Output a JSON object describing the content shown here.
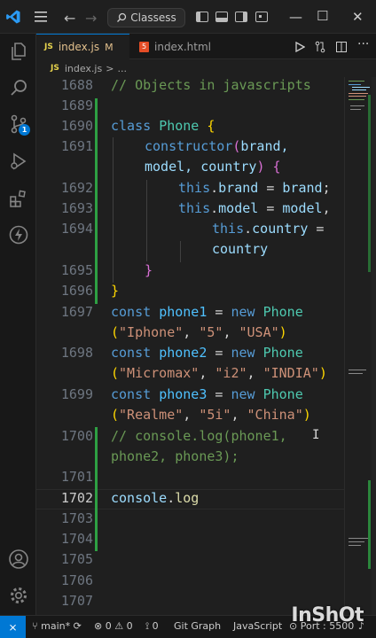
{
  "titlebar": {
    "search": "Classess",
    "icons": [
      "vscode-logo-icon",
      "menu-icon",
      "back-arrow-icon",
      "forward-arrow-icon",
      "search-icon",
      "layout-sidebar-left-icon",
      "layout-panel-icon",
      "layout-sidebar-right-icon",
      "customize-layout-icon",
      "minimize-icon",
      "maximize-icon",
      "close-icon"
    ]
  },
  "activitybar": {
    "icons": [
      "explorer-icon",
      "search-icon",
      "source-control-icon",
      "run-debug-icon",
      "extensions-icon",
      "lightning-icon",
      "account-icon",
      "settings-gear-icon"
    ],
    "scm_badge": "1"
  },
  "tabs": [
    {
      "icon": "JS",
      "label": "index.js",
      "modified": "M"
    },
    {
      "icon": "5",
      "label": "index.html"
    }
  ],
  "breadcrumb": {
    "icon": "JS",
    "file": "index.js",
    "sep": ">",
    "more": "..."
  },
  "editor": {
    "line_numbers": [
      "1688",
      "1689",
      "1690",
      "1691",
      "",
      "1692",
      "1693",
      "1694",
      "",
      "1695",
      "1696",
      "1697",
      "",
      "1698",
      "",
      "1699",
      "",
      "1700",
      "",
      "1701",
      "1702",
      "1703",
      "1704",
      "1705",
      "1706",
      "1707"
    ],
    "current_line": "1702",
    "code": {
      "l1": "// Objects in javascripts",
      "class_kw": "class",
      "class_name": "Phone",
      "ctor": "constructor",
      "ctor_p1": "brand,",
      "ctor_p2": "model,",
      "ctor_p3": "country",
      "this": "this",
      "prop_brand": "brand",
      "prop_model": "model",
      "prop_country": "country",
      "const": "const",
      "new": "new",
      "phone1": "phone1",
      "phone2": "phone2",
      "phone3": "phone3",
      "s_iphone": "\"Iphone\"",
      "s_5": "\"5\"",
      "s_usa": "\"USA\"",
      "s_micromax": "\"Micromax\"",
      "s_i2": "\"i2\"",
      "s_india": "\"INDIA\"",
      "s_realme": "\"Realme\"",
      "s_5i": "\"5i\"",
      "s_china": "\"China\"",
      "c1": "// console.log(phone1,",
      "c2": "phone2, phone3);",
      "cur_console": "console",
      "cur_log": "log"
    }
  },
  "statusbar": {
    "remote_icon": "remote-icon",
    "branch": "main*",
    "errors": "0",
    "warnings": "0",
    "ports": "0",
    "git_graph": "Git Graph",
    "language": "JavaScript",
    "port": "Port : 5500"
  },
  "watermark": "InShOt",
  "colors": {
    "accent": "#0078d4",
    "modified_bar": "#2ea043"
  }
}
